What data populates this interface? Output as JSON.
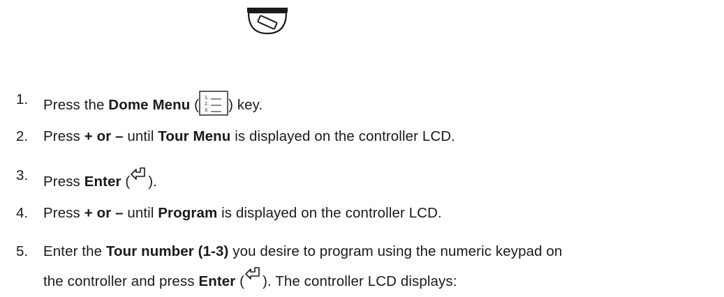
{
  "steps": [
    {
      "num": "1.",
      "pre": "Press the ",
      "key": "Dome Menu",
      "open": " (",
      "close": ") key."
    },
    {
      "num": "2.",
      "pre": "Press ",
      "plus": "+",
      "or": " or –",
      "mid": " until ",
      "key": "Tour Menu",
      "post": " is displayed on the controller LCD."
    },
    {
      "num": "3.",
      "pre": "Press ",
      "key": "Enter",
      "open": " (",
      "close": ")."
    },
    {
      "num": "4.",
      "pre": "Press ",
      "plus": "+",
      "or": " or –",
      "mid": " until ",
      "key": "Program",
      "post": " is displayed on the controller LCD."
    },
    {
      "num": "5.",
      "pre": "Enter the ",
      "key": "Tour number (1-3)",
      "post": " you desire to program using the numeric keypad on",
      "line2_pre": "the controller and press ",
      "line2_key": "Enter",
      "open": " (",
      "line2_post": ").  The controller LCD displays:"
    }
  ],
  "icons": {
    "dome": "dome-icon",
    "menu": "menu-list-icon",
    "enter": "enter-key-icon",
    "menu_lines": [
      "1.",
      "2.",
      "3."
    ]
  }
}
